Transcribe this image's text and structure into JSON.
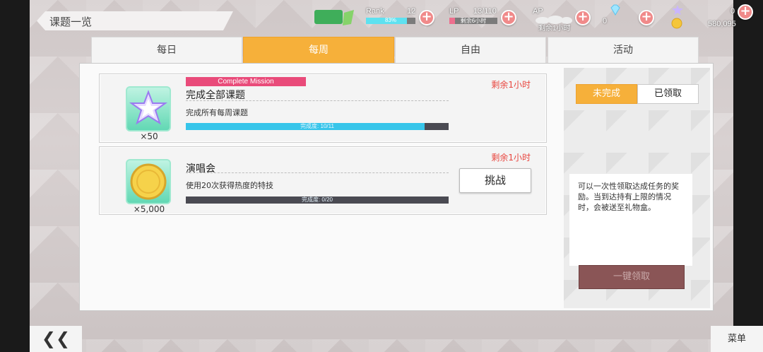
{
  "header": {
    "title": "课题一览",
    "rank_label": "Rank",
    "rank_value": "12",
    "rank_percent_text": "83%",
    "rank_progress": 0.83,
    "lp_label": "LP",
    "lp_value": "13/110",
    "lp_sub": "剩余6小时",
    "lp_progress": 0.12,
    "ap_label": "AP",
    "ap_sub": "剩余1小时",
    "gem_count": "0",
    "star_count": "0",
    "coin_count": "580,095"
  },
  "tabs": [
    {
      "label": "每日"
    },
    {
      "label": "每周"
    },
    {
      "label": "自由"
    },
    {
      "label": "活动"
    }
  ],
  "missions": [
    {
      "tag": "Complete Mission",
      "title": "完成全部课题",
      "description": "完成所有每周课题",
      "remain": "剩余1小时",
      "qty": "×50",
      "progress_text": "完成度: 10/11",
      "progress": 0.909
    },
    {
      "title": "演唱会",
      "description": "使用20次获得热度的特技",
      "remain": "剩余1小时",
      "qty": "×5,000",
      "progress_text": "完成度: 0/20",
      "progress": 0,
      "button": "挑战"
    }
  ],
  "filter": {
    "incomplete": "未完成",
    "claimed": "已领取"
  },
  "info_text": "可以一次性领取达成任务的奖励。当到达持有上限的情况时，会被送至礼物盒。",
  "claim_all": "一键领取",
  "footer": {
    "back": "❮❮",
    "menu": "菜单"
  },
  "colors": {
    "accent": "#f6b03a",
    "progress": "#37c5ea",
    "alert": "#e8463f"
  }
}
